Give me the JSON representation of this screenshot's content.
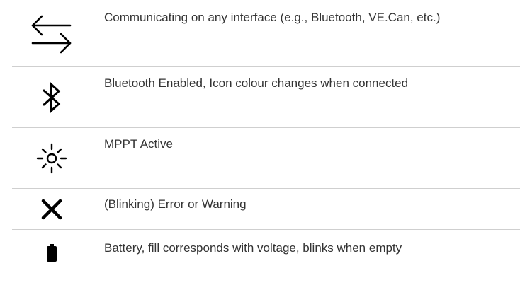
{
  "rows": [
    {
      "icon": "communication-arrows-icon",
      "description": "Communicating on any interface (e.g., Bluetooth, VE.Can, etc.)"
    },
    {
      "icon": "bluetooth-icon",
      "description": "Bluetooth Enabled, Icon colour changes when connected"
    },
    {
      "icon": "mppt-sun-icon",
      "description": "MPPT Active"
    },
    {
      "icon": "error-x-icon",
      "description": "(Blinking) Error or Warning"
    },
    {
      "icon": "battery-icon",
      "description": "Battery, fill corresponds with voltage, blinks when empty"
    }
  ],
  "colors": {
    "icon": "#000000",
    "text": "#333333",
    "grid": "#cfcfcf"
  }
}
